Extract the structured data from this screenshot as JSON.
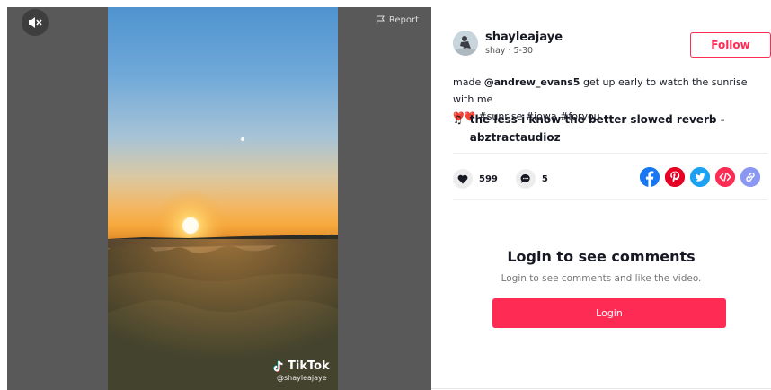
{
  "video": {
    "report_label": "Report",
    "watermark_brand": "TikTok",
    "watermark_user": "@shayleajaye"
  },
  "author": {
    "username": "shayleajaye",
    "nickname": "shay",
    "date": "5-30",
    "sub_separator": " · "
  },
  "follow_label": "Follow",
  "caption": {
    "prefix": "made ",
    "mention": "@andrew_evans5",
    "text": " get up early to watch the sunrise with me",
    "hearts": "❤️❤️",
    "tags": " #sunrise #iowa #foryou"
  },
  "music": {
    "note": "♫",
    "title": "the less i know the better slowed reverb - abztractaudioz"
  },
  "stats": {
    "likes": "599",
    "comments": "5"
  },
  "share_icons": [
    "facebook-icon",
    "pinterest-icon",
    "twitter-icon",
    "embed-icon",
    "link-icon"
  ],
  "colors": {
    "accent": "#fe2c55",
    "facebook": "#1877f2",
    "pinterest": "#e60023",
    "twitter": "#1da1f2",
    "embed": "#fe2c55",
    "link": "#8b98f2"
  },
  "login": {
    "title": "Login to see comments",
    "subtitle": "Login to see comments and like the video.",
    "button_label": "Login"
  }
}
